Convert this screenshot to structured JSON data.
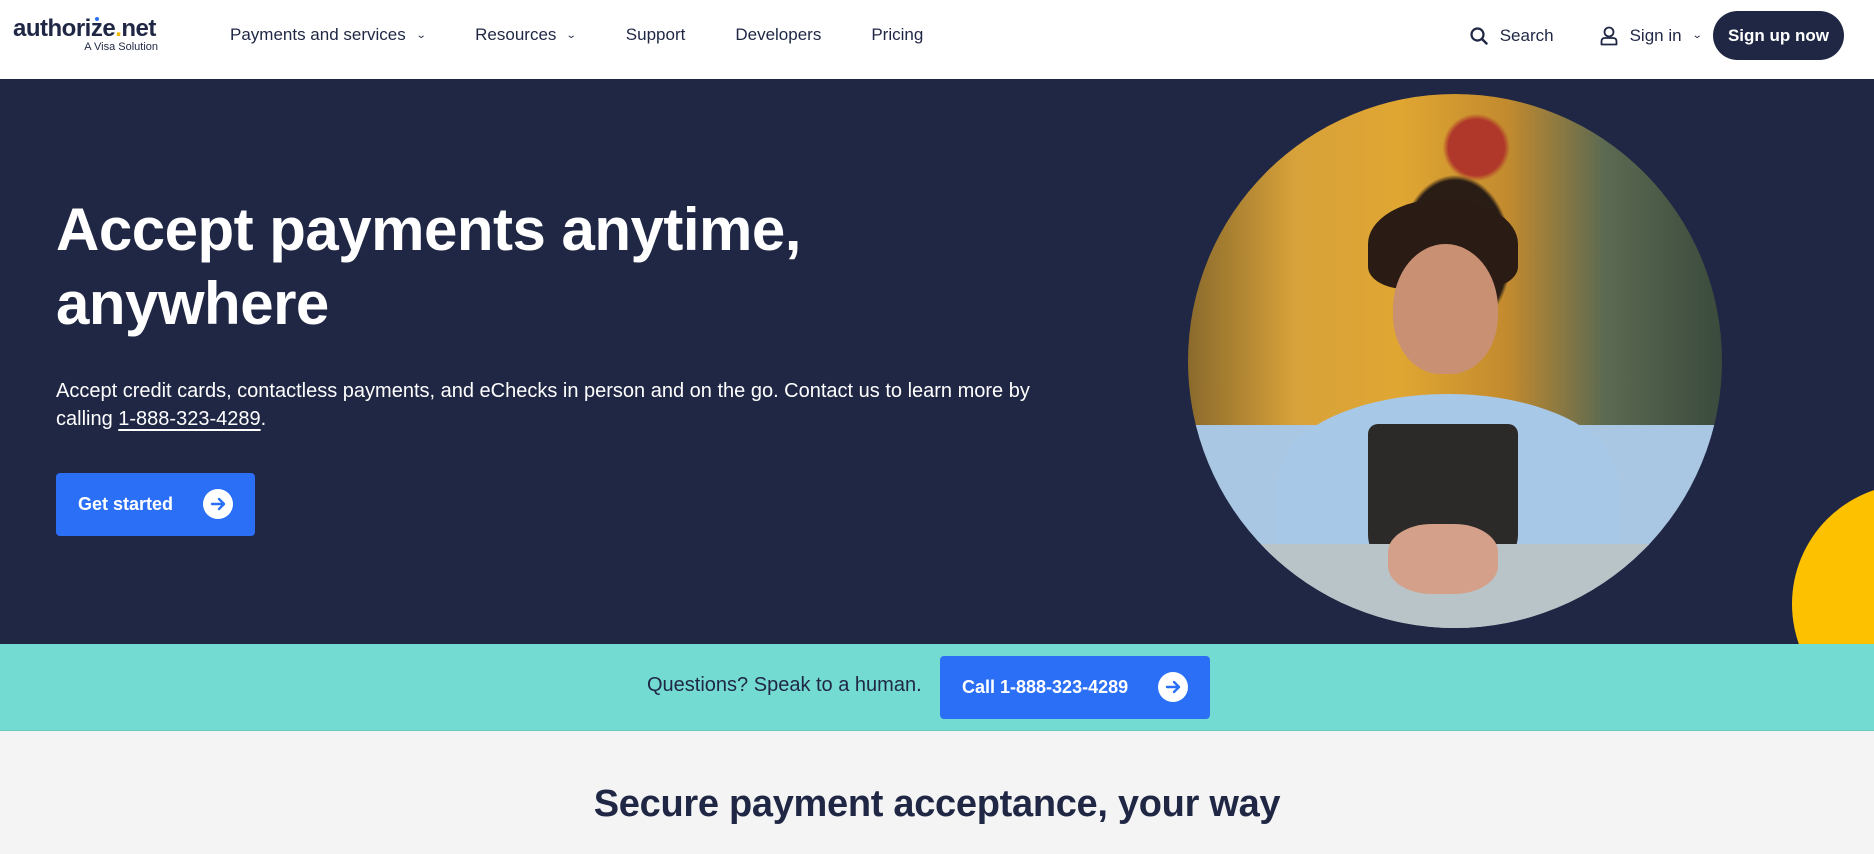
{
  "nav": {
    "logo": {
      "main_prefix": "authorize",
      "main_dot": ".",
      "main_suffix": "net",
      "sub": "A Visa Solution"
    },
    "links": [
      {
        "label": "Payments and services",
        "has_dropdown": true
      },
      {
        "label": "Resources",
        "has_dropdown": true
      },
      {
        "label": "Support",
        "has_dropdown": false
      },
      {
        "label": "Developers",
        "has_dropdown": false
      },
      {
        "label": "Pricing",
        "has_dropdown": false
      }
    ],
    "search_label": "Search",
    "search_icon": "search-icon",
    "signin_label": "Sign in",
    "signin_icon": "user-icon",
    "signup_label": "Sign up now",
    "chevron": "⌄"
  },
  "hero": {
    "title": "Accept payments anytime, anywhere",
    "text_before": "Accept credit cards, contactless payments, and eChecks in person and on the go. Contact us to learn more by calling ",
    "phone": "1-888-323-4289",
    "text_after": ".",
    "cta_label": "Get started",
    "cta_icon": "arrow-right-circle-icon",
    "image_alt": "Smiling bartender leaning on bar counter"
  },
  "call_band": {
    "text": "Questions? Speak to a human.",
    "button_label": "Call 1-888-323-4289",
    "button_icon": "arrow-right-circle-icon"
  },
  "secure": {
    "title": "Secure payment acceptance, your way"
  },
  "colors": {
    "navy": "#1f2744",
    "blue": "#2a6ff6",
    "teal": "#74dbd3",
    "yellow": "#fec100",
    "light_grey": "#f4f4f4",
    "white": "#ffffff"
  }
}
